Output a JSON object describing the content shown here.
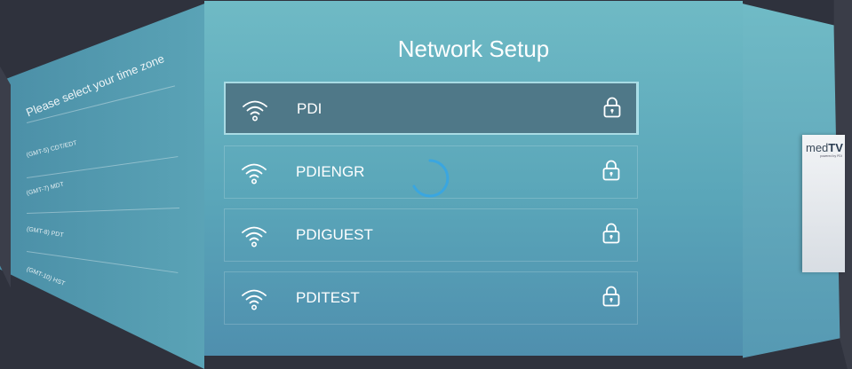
{
  "header": {
    "title": "Network Setup"
  },
  "networks": [
    {
      "name": "PDI",
      "selected": true,
      "secured": true
    },
    {
      "name": "PDIENGR",
      "selected": false,
      "secured": true
    },
    {
      "name": "PDIGUEST",
      "selected": false,
      "secured": true
    },
    {
      "name": "PDITEST",
      "selected": false,
      "secured": true
    }
  ],
  "left_panel": {
    "title": "Please select your time zone",
    "items": [
      "(GMT-5) CDT/EDT",
      "(GMT-7) MDT",
      "(GMT-8) PDT",
      "(GMT-10) HST"
    ]
  },
  "brand": {
    "logo_main": "med",
    "logo_accent": "TV",
    "logo_sub": "powered by PDI"
  },
  "status": {
    "loading": true
  },
  "icons": {
    "network": "wifi-icon",
    "secured": "lock-icon",
    "loading": "spinner-icon"
  },
  "colors": {
    "selected_bg": "#4f7888",
    "panel_top": "#6fbac5",
    "panel_bottom": "#4f8fae"
  }
}
